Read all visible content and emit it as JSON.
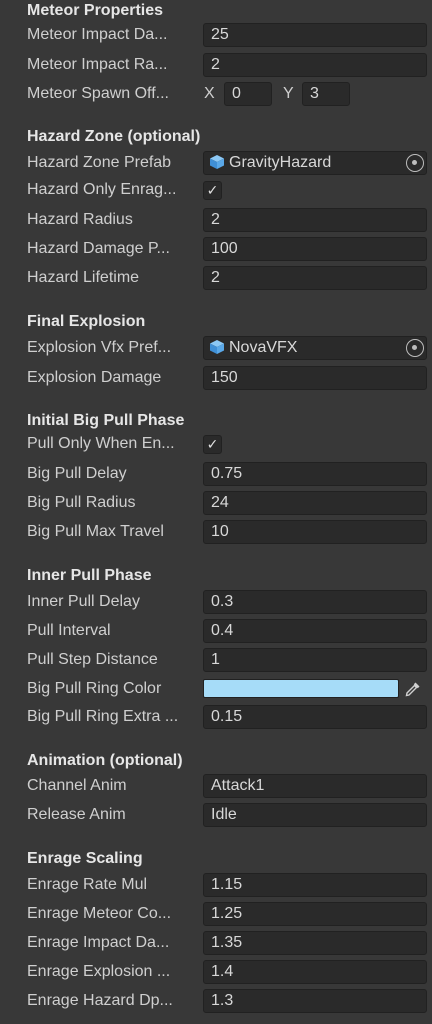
{
  "sections": {
    "meteor": "Meteor Properties",
    "hazard": "Hazard Zone (optional)",
    "final": "Final Explosion",
    "bigpull": "Initial Big Pull Phase",
    "inner": "Inner Pull Phase",
    "anim": "Animation (optional)",
    "enrage": "Enrage Scaling"
  },
  "meteor": {
    "impact_damage": {
      "label": "Meteor Impact Da...",
      "value": "25"
    },
    "impact_radius": {
      "label": "Meteor Impact Ra...",
      "value": "2"
    },
    "spawn_offset": {
      "label": "Meteor Spawn Off...",
      "x_label": "X",
      "x": "0",
      "y_label": "Y",
      "y": "3"
    }
  },
  "hazard": {
    "prefab": {
      "label": "Hazard Zone Prefab",
      "value": "GravityHazard",
      "icon": "prefab-cube-icon"
    },
    "only_enraged": {
      "label": "Hazard Only Enrag...",
      "checked": "✓"
    },
    "radius": {
      "label": "Hazard Radius",
      "value": "2"
    },
    "damage": {
      "label": "Hazard Damage P...",
      "value": "100"
    },
    "lifetime": {
      "label": "Hazard Lifetime",
      "value": "2"
    }
  },
  "final": {
    "vfx": {
      "label": "Explosion Vfx Pref...",
      "value": "NovaVFX",
      "icon": "prefab-cube-icon"
    },
    "damage": {
      "label": "Explosion Damage",
      "value": "150"
    }
  },
  "bigpull": {
    "only_when": {
      "label": "Pull Only When En...",
      "checked": "✓"
    },
    "delay": {
      "label": "Big Pull Delay",
      "value": "0.75"
    },
    "radius": {
      "label": "Big Pull Radius",
      "value": "24"
    },
    "max_travel": {
      "label": "Big Pull Max Travel",
      "value": "10"
    }
  },
  "inner": {
    "delay": {
      "label": "Inner Pull Delay",
      "value": "0.3"
    },
    "interval": {
      "label": "Pull Interval",
      "value": "0.4"
    },
    "step": {
      "label": "Pull Step Distance",
      "value": "1"
    },
    "ring_color": {
      "label": "Big Pull Ring Color",
      "color": "#a6dcf8"
    },
    "ring_extra": {
      "label": "Big Pull Ring Extra ...",
      "value": "0.15"
    }
  },
  "anim": {
    "channel": {
      "label": "Channel Anim",
      "value": "Attack1"
    },
    "release": {
      "label": "Release Anim",
      "value": "Idle"
    }
  },
  "enrage": {
    "rate": {
      "label": "Enrage Rate Mul",
      "value": "1.15"
    },
    "meteor_count": {
      "label": "Enrage Meteor Co...",
      "value": "1.25"
    },
    "impact": {
      "label": "Enrage Impact Da...",
      "value": "1.35"
    },
    "explosion": {
      "label": "Enrage Explosion ...",
      "value": "1.4"
    },
    "hazard_dps": {
      "label": "Enrage Hazard Dp...",
      "value": "1.3"
    }
  },
  "colors": {
    "background": "#383838",
    "field": "#2a2a2a",
    "prefab_icon": "#5aa8e8"
  }
}
